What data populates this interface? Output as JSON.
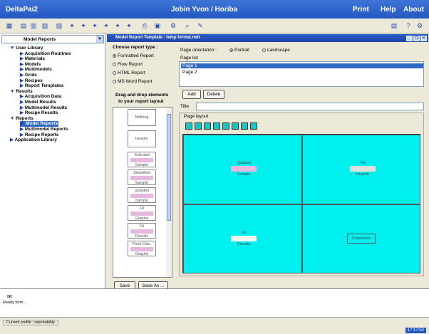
{
  "app": {
    "title": "DeltaPai2",
    "center_title": "Jobin Yvon / Horiba",
    "menu": [
      "Print",
      "Help",
      "About"
    ]
  },
  "left_pane": {
    "selector_label": "Model Reports",
    "tree": [
      {
        "label": "User Library",
        "level": 0,
        "expanded": true
      },
      {
        "label": "Acquisition Routines",
        "level": 1
      },
      {
        "label": "Materials",
        "level": 1
      },
      {
        "label": "Models",
        "level": 1
      },
      {
        "label": "Multimodels",
        "level": 1
      },
      {
        "label": "Grids",
        "level": 1
      },
      {
        "label": "Recipes",
        "level": 1
      },
      {
        "label": "Report Templates",
        "level": 1
      },
      {
        "label": "Results",
        "level": 0,
        "expanded": true
      },
      {
        "label": "Acquisition Data",
        "level": 1
      },
      {
        "label": "Model Results",
        "level": 1
      },
      {
        "label": "Multimodel Results",
        "level": 1
      },
      {
        "label": "Recipe Results",
        "level": 1
      },
      {
        "label": "Reports",
        "level": 0,
        "expanded": true
      },
      {
        "label": "Model Reports",
        "level": 1,
        "selected": true
      },
      {
        "label": "Multimodel Reports",
        "level": 1
      },
      {
        "label": "Recipe Reports",
        "level": 1
      },
      {
        "label": "Application Library",
        "level": 0
      }
    ]
  },
  "doc_window": {
    "title": "Model Report Template : temp format.mdt"
  },
  "report_type": {
    "heading": "Choose report type :",
    "options": [
      "Formatted Report",
      "Flow Report",
      "HTML Report",
      "MS Word Report"
    ],
    "selected_index": 0
  },
  "elements": {
    "heading_line1": "Drag and drop elements",
    "heading_line2": "to your report layout",
    "items": [
      {
        "label": "Nothing",
        "sub": ""
      },
      {
        "label": "Header",
        "sub": ""
      },
      {
        "label": "Selected",
        "sub": "Sample"
      },
      {
        "label": "Simplified",
        "sub": "Sample"
      },
      {
        "label": "Updated",
        "sub": "Sample"
      },
      {
        "label": "Fit",
        "sub": "Graphic"
      },
      {
        "label": "Fit",
        "sub": "Results"
      },
      {
        "label": "Point Calc.",
        "sub": "Graphic"
      }
    ],
    "save_label": "Save",
    "save_as_label": "Save As ..."
  },
  "page": {
    "orientation_label": "Page orientation :",
    "portrait": "Portrait",
    "landscape": "Landscape",
    "orientation_selected": "Portrait",
    "list_label": "Page list",
    "pages": [
      "Page 1",
      "Page 2"
    ],
    "selected_page": 0,
    "add_label": "Add",
    "delete_label": "Delete",
    "title_label": "Title",
    "title_value": "",
    "layout_label": "Page layout",
    "cells": [
      {
        "line1": "Updated",
        "line2": "Sample"
      },
      {
        "line1": "Fit",
        "line2": "Graphic"
      },
      {
        "line1": "Fit",
        "line2": "Results"
      },
      {
        "line1": "Comments",
        "line2": ""
      }
    ]
  },
  "status": {
    "message": "Ready form...",
    "profile": "Current profile : reportability",
    "clock": "17:17:52"
  },
  "colors": {
    "accent": "#2257c2",
    "canvas": "#00f0f0",
    "selection": "#316ac5"
  }
}
